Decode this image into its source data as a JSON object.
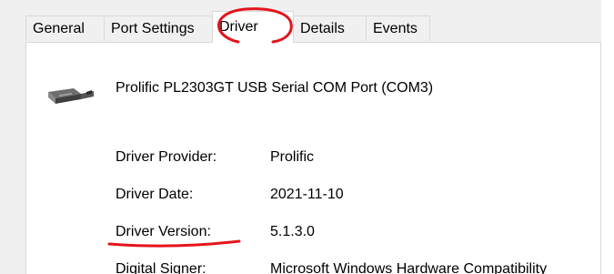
{
  "tabs": [
    {
      "label": "General"
    },
    {
      "label": "Port Settings"
    },
    {
      "label": "Driver",
      "selected": true
    },
    {
      "label": "Details"
    },
    {
      "label": "Events"
    }
  ],
  "device": {
    "icon": "serial-port-connector-icon",
    "name": "Prolific PL2303GT USB Serial COM Port (COM3)"
  },
  "properties": [
    {
      "label": "Driver Provider:",
      "value": "Prolific"
    },
    {
      "label": "Driver Date:",
      "value": "2021-11-10"
    },
    {
      "label": "Driver Version:",
      "value": "5.1.3.0"
    },
    {
      "label": "Digital Signer:",
      "value": "Microsoft Windows Hardware Compatibility"
    }
  ],
  "annotations": {
    "color": "#e3141b",
    "circled": "Driver",
    "underlined": "Driver Version:"
  }
}
